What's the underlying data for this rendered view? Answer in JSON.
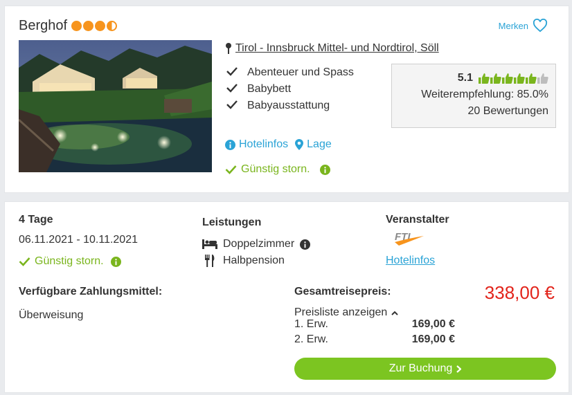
{
  "hotel": {
    "name": "Berghof",
    "rating_dots": 3.5,
    "merken_label": "Merken",
    "location": "Tirol - Innsbruck Mittel- und Nordtirol, Söll",
    "features": [
      "Abenteuer und Spass",
      "Babybett",
      "Babyausstattung"
    ],
    "links": {
      "hotelinfos": "Hotelinfos",
      "lage": "Lage"
    },
    "storno": "Günstig storn."
  },
  "review": {
    "score": "5.1",
    "thumbs_filled": 5,
    "thumbs_total": 6,
    "recommendation": "Weiterempfehlung: 85.0%",
    "count": "20 Bewertungen"
  },
  "offer": {
    "duration": "4 Tage",
    "dates": "06.11.2021 - 10.11.2021",
    "storno": "Günstig storn.",
    "services_title": "Leistungen",
    "room": "Doppelzimmer",
    "board": "Halbpension",
    "operator_title": "Veranstalter",
    "operator_logo": "FTI",
    "operator_link": "Hotelinfos",
    "payment_title": "Verfügbare Zahlungsmittel:",
    "payment_method": "Überweisung",
    "total_title": "Gesamtreisepreis:",
    "total_price": "338,00 €",
    "pricelist_label": "Preisliste anzeigen",
    "price_rows": [
      {
        "label": "1. Erw.",
        "amount": "169,00 €"
      },
      {
        "label": "2. Erw.",
        "amount": "169,00 €"
      }
    ],
    "book_label": "Zur Buchung"
  },
  "colors": {
    "accent_blue": "#2aa3d6",
    "green": "#7ab51d",
    "button_green": "#7cc521",
    "price_red": "#e2231a",
    "star_orange": "#f7941d"
  }
}
